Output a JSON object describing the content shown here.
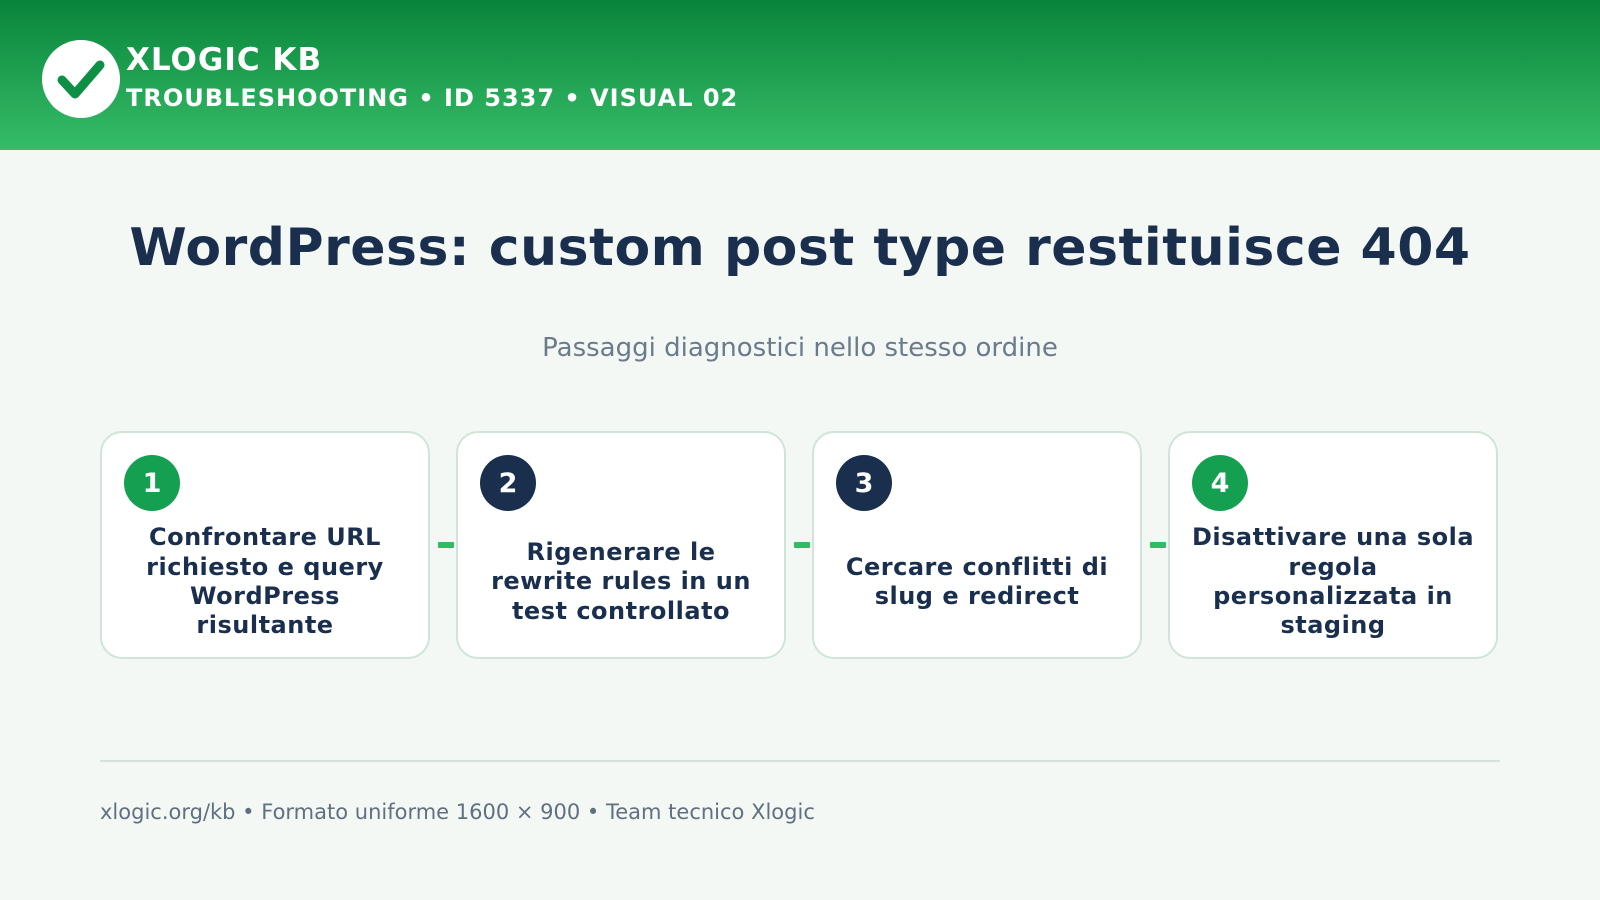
{
  "header": {
    "brand": "XLOGIC KB",
    "subtitle": "TROUBLESHOOTING • ID 5337 • VISUAL 02",
    "logo_icon": "checkmark-icon"
  },
  "main": {
    "title": "WordPress: custom post type restituisce 404",
    "subtitle": "Passaggi diagnostici nello stesso ordine",
    "steps": [
      {
        "number": "1",
        "text": "Confrontare URL richiesto e query WordPress risultante",
        "badge_color": "#14a050"
      },
      {
        "number": "2",
        "text": "Rigenerare le rewrite rules in un test controllato",
        "badge_color": "#1a2f4d"
      },
      {
        "number": "3",
        "text": "Cercare conflitti di slug e redirect",
        "badge_color": "#1a2f4d"
      },
      {
        "number": "4",
        "text": "Disattivare una sola regola personalizzata in staging",
        "badge_color": "#14a050"
      }
    ]
  },
  "footer": {
    "text": "xlogic.org/kb • Formato uniforme 1600 × 900 • Team tecnico Xlogic"
  },
  "colors": {
    "header_top": "#08843a",
    "header_bottom": "#36bd68",
    "accent_green": "#14a050",
    "navy": "#1a2f4d",
    "connector": "#2dbb64"
  }
}
